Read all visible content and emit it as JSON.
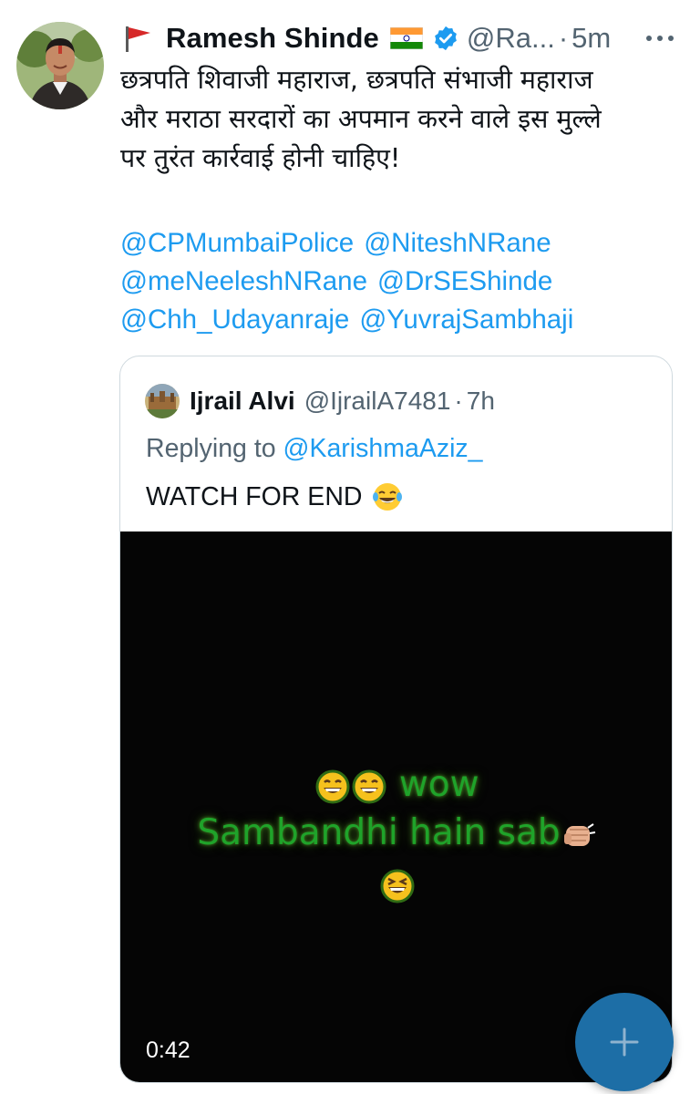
{
  "tweet": {
    "author": {
      "name": "Ramesh Shinde",
      "handle": "@Ra...",
      "time": "5m",
      "separator": "·"
    },
    "body_lines": [
      "छत्रपति शिवाजी महाराज, छत्रपति संभाजी महाराज",
      "और मराठा सरदारों का अपमान करने वाले इस मुल्ले",
      "पर तुरंत कार्रवाई होनी चाहिए!"
    ],
    "mentions": [
      "@CPMumbaiPolice",
      "@NiteshNRane",
      "@meNeeleshNRane",
      "@DrSEShinde",
      "@Chh_Udayanraje",
      "@YuvrajSambhaji"
    ]
  },
  "quoted": {
    "name": "Ijrail Alvi",
    "handle": "@IjrailA7481",
    "separator": "·",
    "time": "7h",
    "replying_prefix": "Replying to ",
    "replying_to": "@KarishmaAziz_",
    "text": "WATCH FOR END",
    "video": {
      "caption_line1": "wow",
      "caption_line2": "Sambandhi hain sab",
      "duration": "0:42"
    }
  },
  "icons": {
    "red_flag": "red-flag-icon",
    "india_flag": "india-flag-icon",
    "verified": "verified-badge-icon",
    "more": "more-options-icon",
    "laugh": "tears-of-joy-emoji",
    "compose": "plus-icon"
  },
  "colors": {
    "link": "#1d9bf0",
    "secondary_text": "#536471",
    "fab": "#1d6ea6",
    "caption_green": "#1fa32a"
  }
}
